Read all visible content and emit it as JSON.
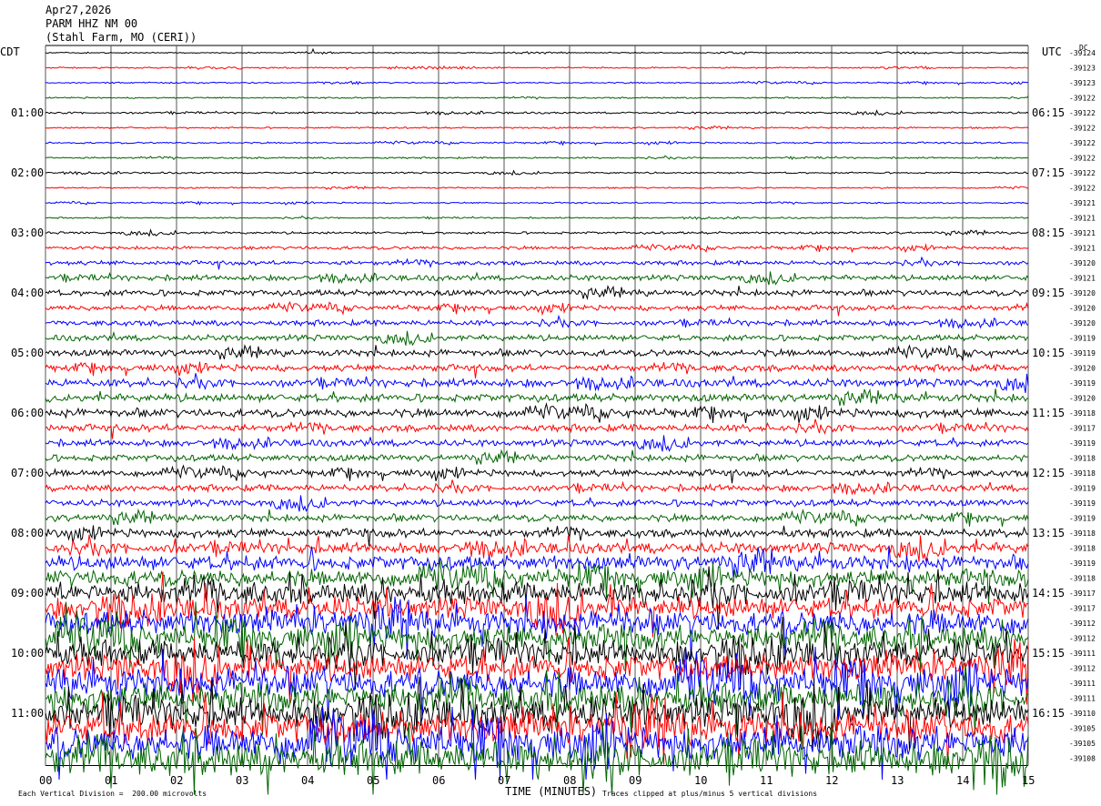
{
  "header": {
    "date": "Apr27,2026",
    "station": "PARM HHZ NM 00",
    "location": "(Stahl Farm, MO (CERI))"
  },
  "axes": {
    "left_tz": "CDT",
    "right_tz": "UTC",
    "dc_label": "DC",
    "x_title": "TIME (MINUTES)"
  },
  "footer": {
    "scale_note": "Each Vertical Division =  200.00 microvolts",
    "clip_note": "Traces clipped at plus/minus 5 vertical divisions"
  },
  "chart_data": {
    "type": "line",
    "title": "PARM HHZ NM 00",
    "xlabel": "TIME (MINUTES)",
    "x_ticks": [
      "00",
      "01",
      "02",
      "03",
      "04",
      "05",
      "06",
      "07",
      "08",
      "09",
      "10",
      "11",
      "12",
      "13",
      "14",
      "15"
    ],
    "xlim": [
      0,
      15
    ],
    "left_time_labels": [
      "01:00",
      "02:00",
      "03:00",
      "04:00",
      "05:00",
      "06:00",
      "07:00",
      "08:00",
      "09:00",
      "10:00",
      "11:00"
    ],
    "right_time_labels": [
      "06:15",
      "07:15",
      "08:15",
      "09:15",
      "10:15",
      "11:15",
      "12:15",
      "13:15",
      "14:15",
      "15:15",
      "16:15"
    ],
    "trace_colors": [
      "#000000",
      "#ff0000",
      "#0000ff",
      "#006400"
    ],
    "dc_offsets": [
      "-39124",
      "-39123",
      "-39123",
      "-39122",
      "-39122",
      "-39122",
      "-39122",
      "-39122",
      "-39122",
      "-39122",
      "-39121",
      "-39121",
      "-39121",
      "-39121",
      "-39120",
      "-39121",
      "-39120",
      "-39120",
      "-39120",
      "-39119",
      "-39119",
      "-39120",
      "-39119",
      "-39120",
      "-39118",
      "-39117",
      "-39119",
      "-39118",
      "-39118",
      "-39119",
      "-39119",
      "-39119",
      "-39118",
      "-39118",
      "-39119",
      "-39118",
      "-39117",
      "-39117",
      "-39112",
      "-39112",
      "-39111",
      "-39112",
      "-39111",
      "-39111",
      "-39110",
      "-39105",
      "-39105",
      "-39108"
    ],
    "trace_amplitudes": [
      0.5,
      0.6,
      0.6,
      0.6,
      0.8,
      0.7,
      0.7,
      0.7,
      0.7,
      0.6,
      0.6,
      0.6,
      1.0,
      1.4,
      1.8,
      2.3,
      2.5,
      2.2,
      2.3,
      2.5,
      2.8,
      2.8,
      3.3,
      3.3,
      3.5,
      3.0,
      2.8,
      2.8,
      2.8,
      2.8,
      2.8,
      3.0,
      3.5,
      4.5,
      6.0,
      7.0,
      9.0,
      9.0,
      10.0,
      10.5,
      10.5,
      11.0,
      12.0,
      12.0,
      12.5,
      13.0,
      13.5,
      14.0
    ]
  }
}
